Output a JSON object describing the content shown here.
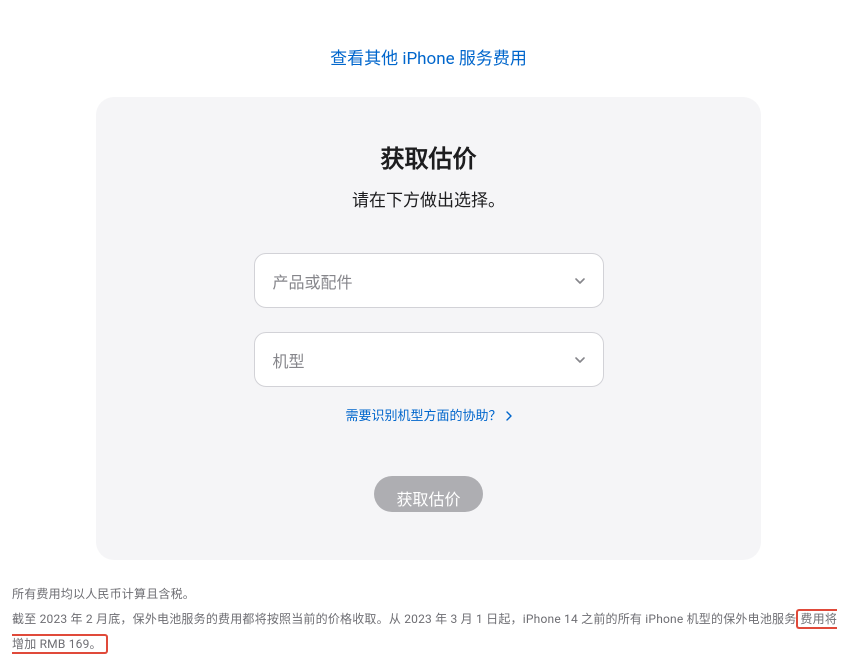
{
  "header": {
    "other_services_link": "查看其他 iPhone 服务费用"
  },
  "card": {
    "title": "获取估价",
    "subtitle": "请在下方做出选择。",
    "product_select": {
      "placeholder": "产品或配件"
    },
    "model_select": {
      "placeholder": "机型"
    },
    "help_link": "需要识别机型方面的协助？",
    "submit_label": "获取估价"
  },
  "footer": {
    "note1": "所有费用均以人民币计算且含税。",
    "note2_prefix": "截至 2023 年 2 月底，保外电池服务的费用都将按照当前的价格收取。从 2023 年 3 月 1 日起，iPhone 14 之前的所有 iPhone 机型的保外电池服务",
    "note2_highlight": "费用将增加 RMB 169。"
  }
}
